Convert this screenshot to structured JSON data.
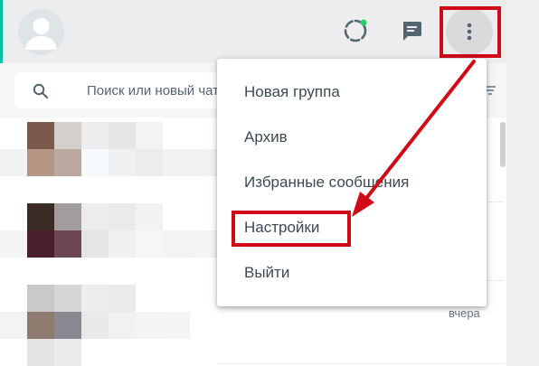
{
  "search": {
    "placeholder": "Поиск или новый чат"
  },
  "menu": {
    "items": [
      {
        "label": "Новая группа"
      },
      {
        "label": "Архив"
      },
      {
        "label": "Избранные сообщения"
      },
      {
        "label": "Настройки"
      },
      {
        "label": "Выйти"
      }
    ]
  },
  "chatlist": {
    "visible_time": "вчера"
  },
  "header": {
    "icons": [
      "avatar",
      "status-icon",
      "new-chat-icon",
      "menu-dots-icon"
    ]
  },
  "colors": {
    "accent": "#00bfa5",
    "highlight": "#d10a17",
    "header_bg": "#ededed",
    "status_dot": "#25d366"
  }
}
